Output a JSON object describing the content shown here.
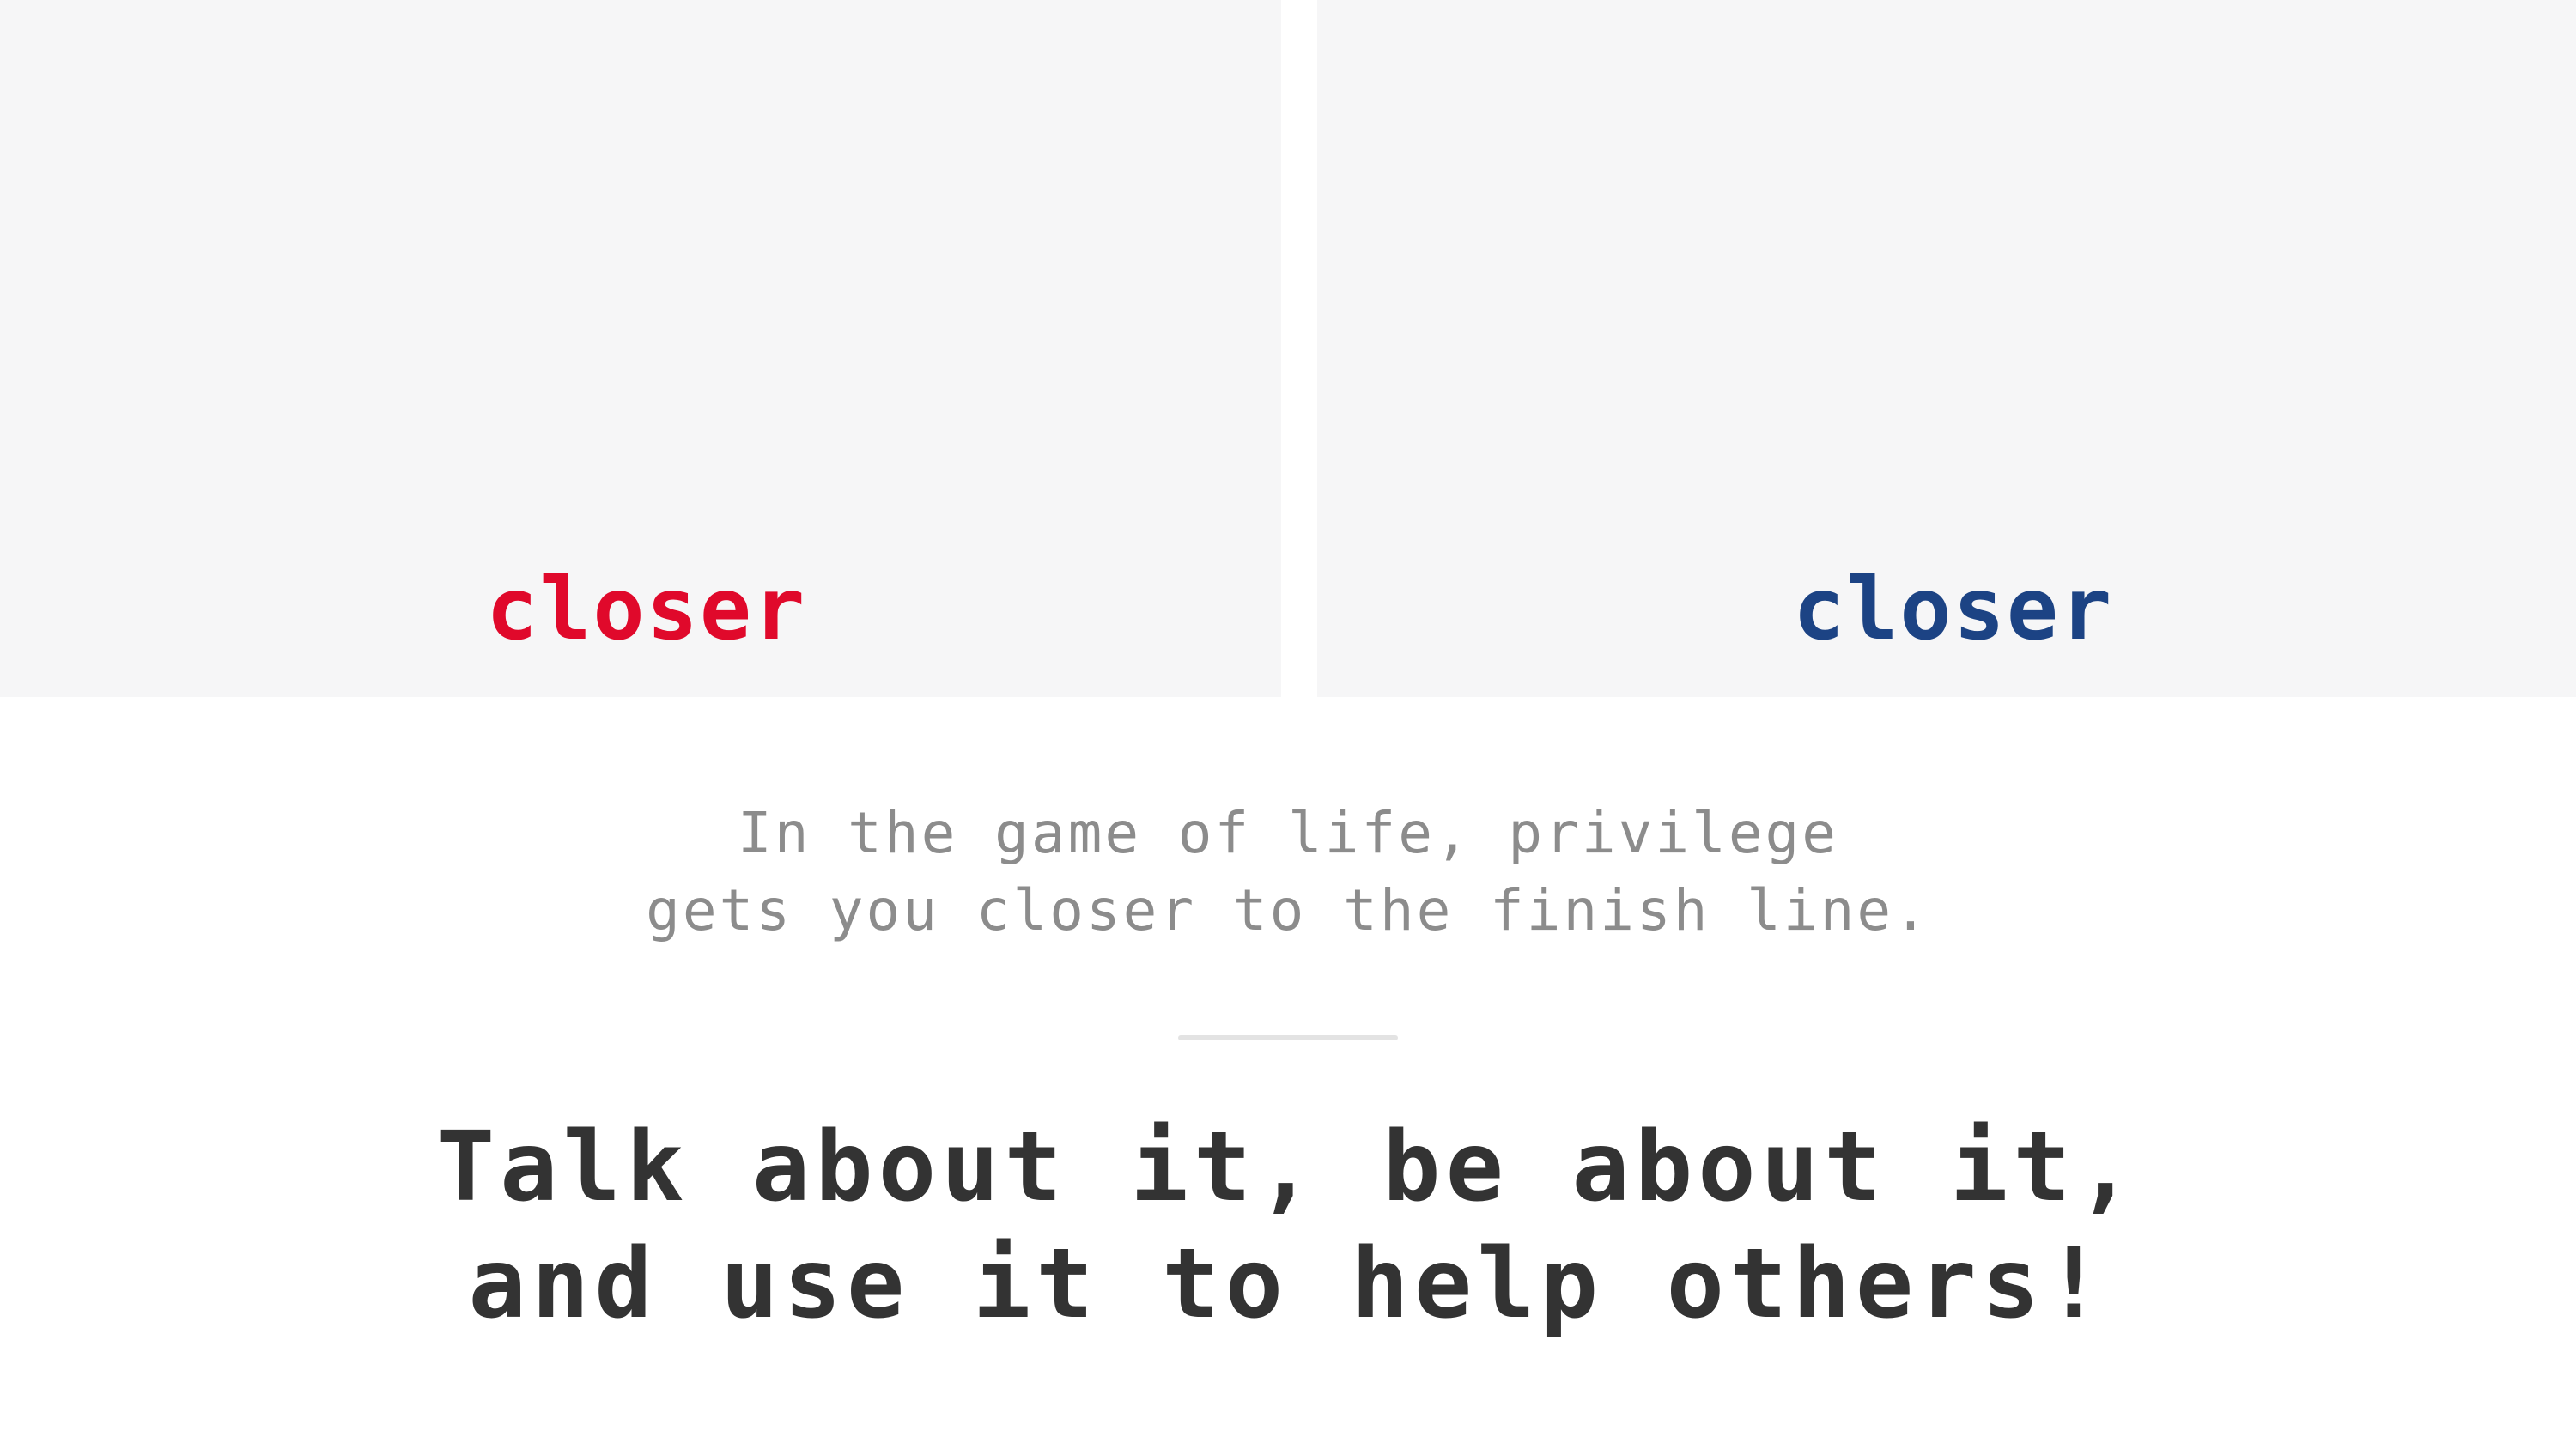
{
  "panels": {
    "left": {
      "word": "closer",
      "color": "#e0092b"
    },
    "right": {
      "word": "closer",
      "color": "#1c4384"
    }
  },
  "caption": {
    "line1": "In the game of life, privilege",
    "line2": "gets you closer to the finish line."
  },
  "headline": {
    "line1": "Talk about it, be about it,",
    "line2": "and use it to help others!"
  },
  "colors": {
    "panel_bg": "#f6f6f7",
    "caption_text": "#8c8c8c",
    "headline_text": "#333333",
    "divider": "#e3e3e3"
  }
}
